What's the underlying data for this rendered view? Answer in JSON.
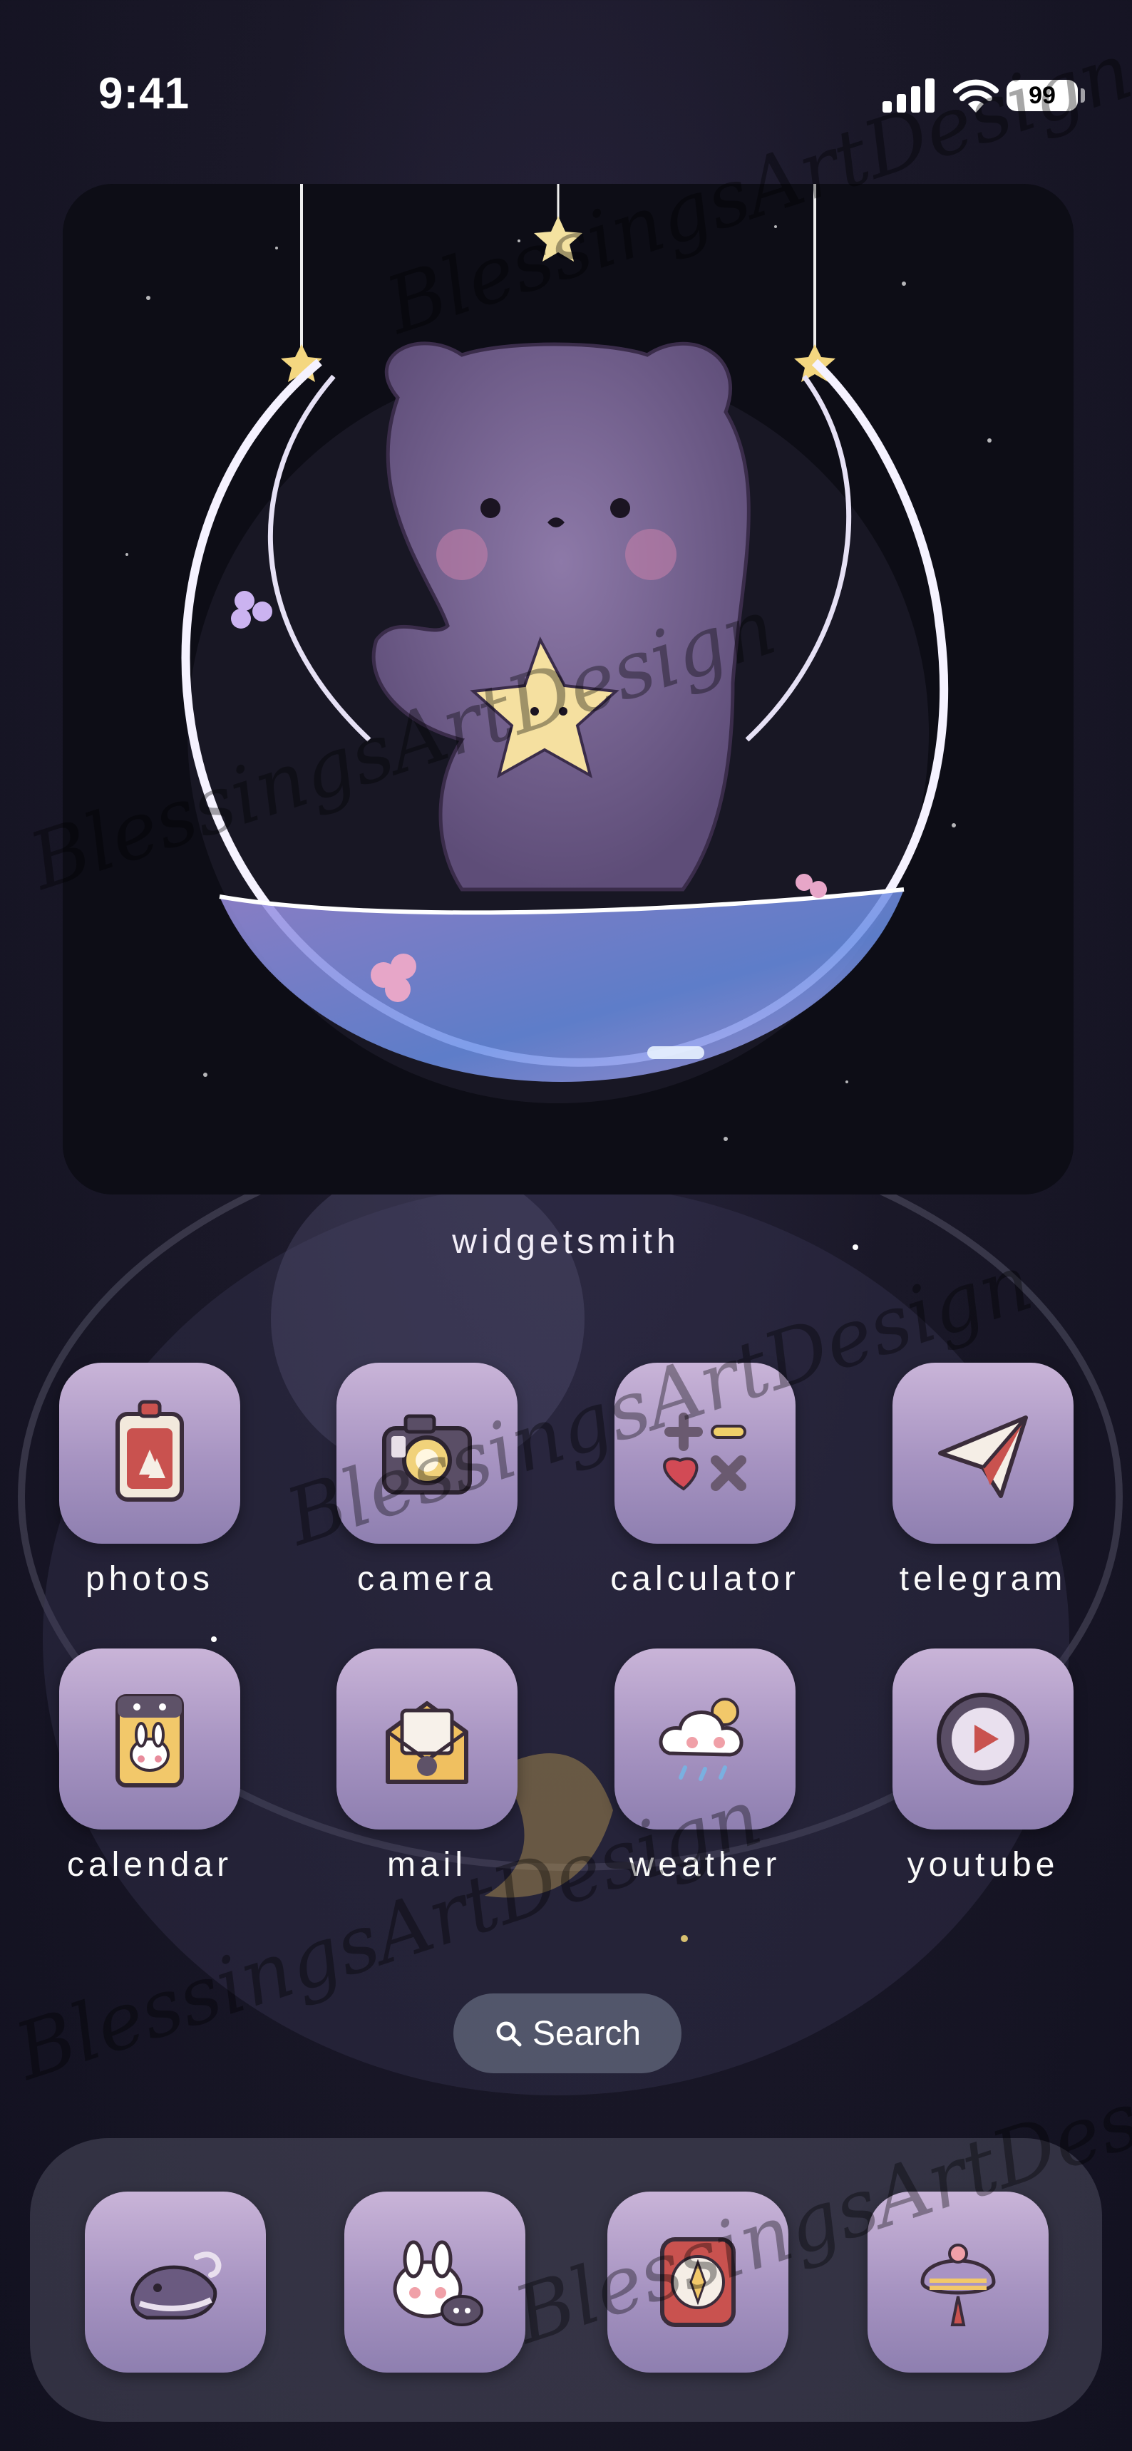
{
  "status_bar": {
    "time": "9:41",
    "battery": "99"
  },
  "widget": {
    "label": "widgetsmith"
  },
  "apps": [
    {
      "label": "photos",
      "icon": "photos-icon"
    },
    {
      "label": "camera",
      "icon": "camera-icon"
    },
    {
      "label": "calculator",
      "icon": "calculator-icon"
    },
    {
      "label": "telegram",
      "icon": "telegram-icon"
    },
    {
      "label": "calendar",
      "icon": "calendar-icon"
    },
    {
      "label": "mail",
      "icon": "mail-icon"
    },
    {
      "label": "weather",
      "icon": "weather-icon"
    },
    {
      "label": "youtube",
      "icon": "youtube-icon"
    }
  ],
  "search": {
    "label": "Search",
    "icon": "search-icon"
  },
  "dock": [
    {
      "icon": "whale-phone-icon"
    },
    {
      "icon": "bunny-messages-icon"
    },
    {
      "icon": "compass-icon"
    },
    {
      "icon": "balloon-icon"
    }
  ],
  "watermark": "BlessingsArtDesign",
  "colors": {
    "icon_top": "#c9b4d8",
    "icon_bottom": "#8e7fb0",
    "background": "#1a1828"
  }
}
